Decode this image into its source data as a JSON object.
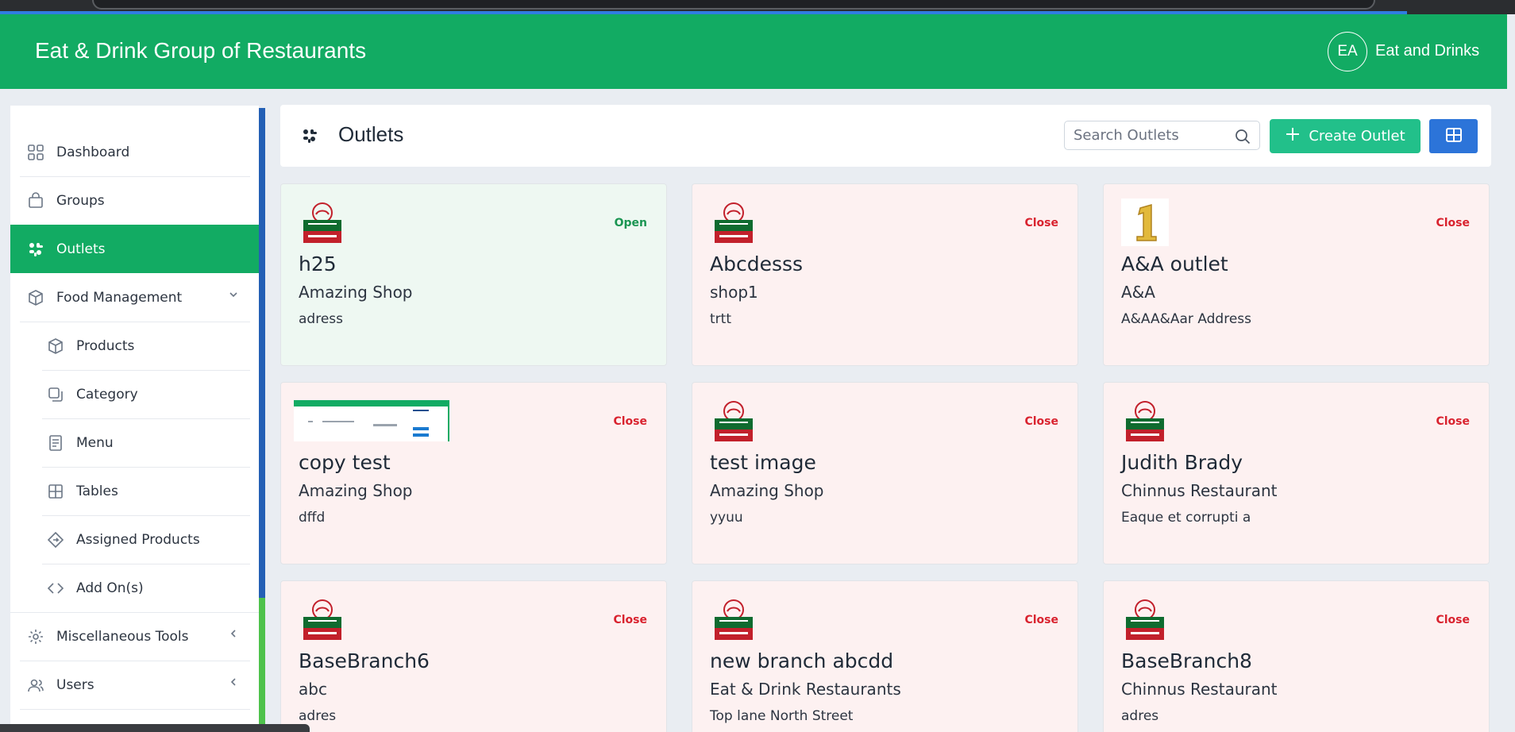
{
  "app": {
    "title": "Eat & Drink Group of Restaurants",
    "user_initials": "EA",
    "user_name": "Eat and Drinks"
  },
  "sidebar": {
    "items": [
      {
        "label": "Dashboard",
        "icon": "dashboard-grid-icon"
      },
      {
        "label": "Groups",
        "icon": "shopping-bag-icon"
      },
      {
        "label": "Outlets",
        "icon": "outlets-icon",
        "active": true
      },
      {
        "label": "Food Management",
        "icon": "box-icon",
        "expandable": true
      },
      {
        "label": "Products",
        "icon": "cube-icon",
        "sub": true
      },
      {
        "label": "Category",
        "icon": "copy-icon",
        "sub": true
      },
      {
        "label": "Menu",
        "icon": "document-icon",
        "sub": true
      },
      {
        "label": "Tables",
        "icon": "table-icon",
        "sub": true
      },
      {
        "label": "Assigned Products",
        "icon": "tag-icon",
        "sub": true
      },
      {
        "label": "Add On(s)",
        "icon": "code-icon",
        "sub": true
      },
      {
        "label": "Miscellaneous Tools",
        "icon": "gear-icon",
        "expandable": true
      },
      {
        "label": "Users",
        "icon": "users-icon",
        "expandable": true
      }
    ]
  },
  "page": {
    "title": "Outlets",
    "search_placeholder": "Search Outlets",
    "create_label": "Create Outlet"
  },
  "outlets": [
    {
      "name": "h25",
      "group": "Amazing Shop",
      "address": "adress",
      "status": "Open",
      "logo": "eat-drink"
    },
    {
      "name": "Abcdesss",
      "group": "shop1",
      "address": "trtt",
      "status": "Close",
      "logo": "eat-drink"
    },
    {
      "name": "A&A outlet",
      "group": "A&A",
      "address": "A&AA&Aar Address",
      "status": "Close",
      "logo": "number-one"
    },
    {
      "name": "copy test",
      "group": "Amazing Shop",
      "address": "dffd",
      "status": "Close",
      "logo": "screenshot"
    },
    {
      "name": "test image",
      "group": "Amazing Shop",
      "address": "yyuu",
      "status": "Close",
      "logo": "eat-drink"
    },
    {
      "name": "Judith Brady",
      "group": "Chinnus Restaurant",
      "address": "Eaque et corrupti a",
      "status": "Close",
      "logo": "eat-drink"
    },
    {
      "name": "BaseBranch6",
      "group": "abc",
      "address": "adres",
      "status": "Close",
      "logo": "eat-drink"
    },
    {
      "name": "new branch abcdd",
      "group": "Eat & Drink Restaurants",
      "address": "Top lane North Street",
      "status": "Close",
      "logo": "eat-drink"
    },
    {
      "name": "BaseBranch8",
      "group": "Chinnus Restaurant",
      "address": "adres",
      "status": "Close",
      "logo": "eat-drink"
    }
  ],
  "colors": {
    "brand_green": "#12ab63",
    "create_button": "#22c08a",
    "grid_button": "#2c74d9",
    "open_text": "#1a9552",
    "close_text": "#d9232f"
  }
}
